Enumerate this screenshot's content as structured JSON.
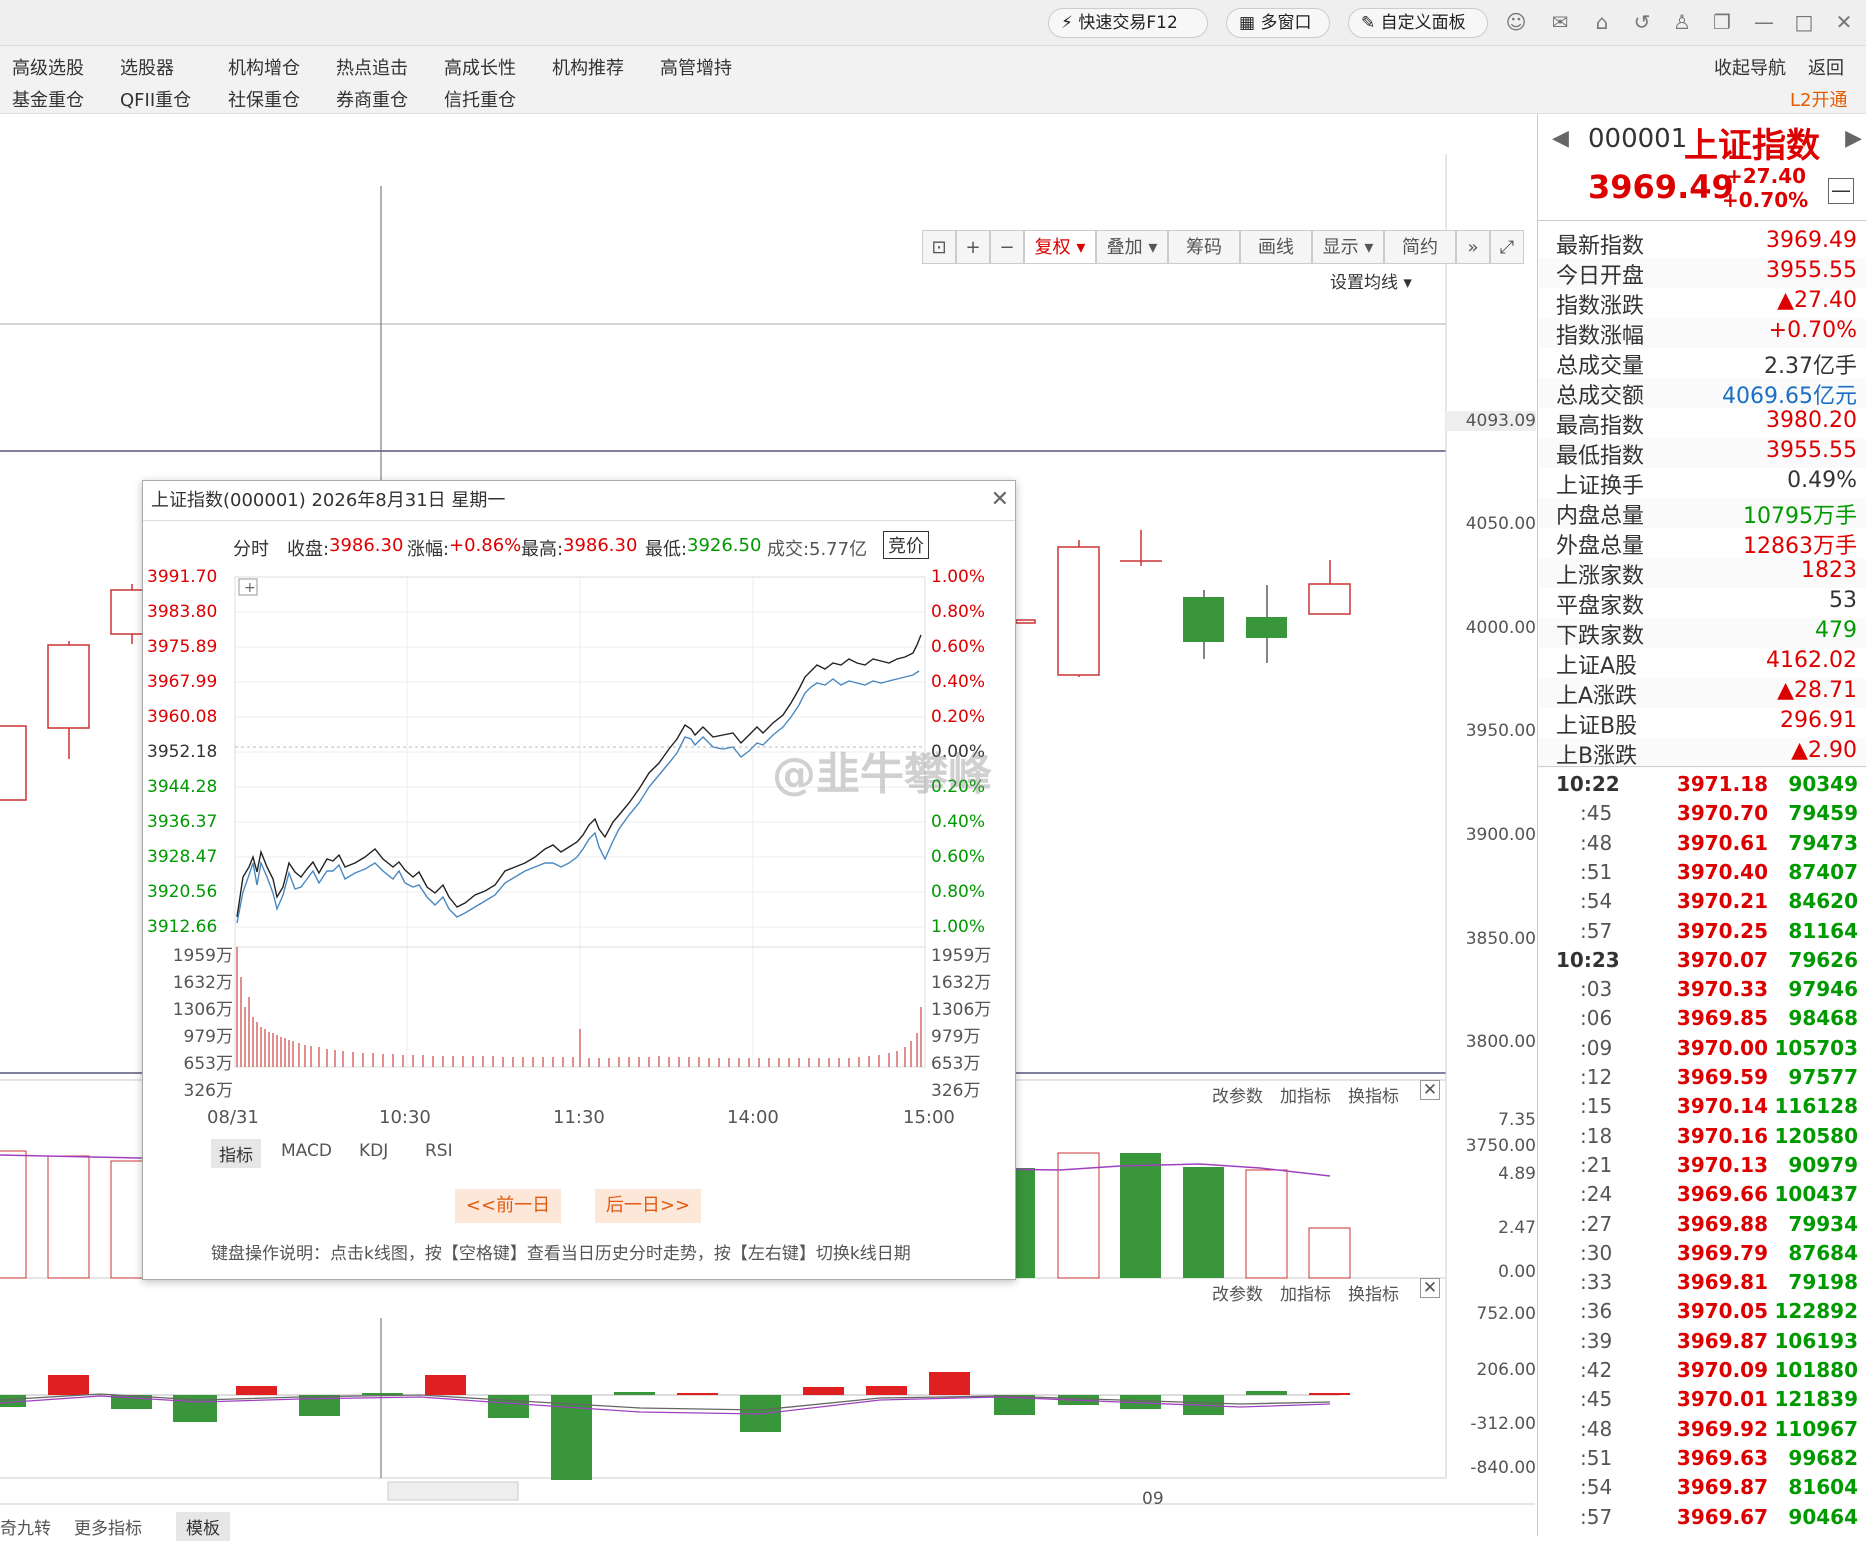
{
  "topbar": {
    "quick_trade": "快速交易F12",
    "multi_window": "多窗口",
    "custom_panel": "自定义面板"
  },
  "nav": {
    "row1": [
      "高级选股",
      "选股器",
      "机构增仓",
      "热点追击",
      "高成长性",
      "机构推荐",
      "高管增持"
    ],
    "row2": [
      "基金重仓",
      "QFII重仓",
      "社保重仓",
      "券商重仓",
      "信托重仓"
    ],
    "collapse": "收起导航",
    "back": "返回",
    "l2": "L2开通"
  },
  "toolbar": {
    "fuquan": "复权",
    "overlay": "叠加",
    "chips": "筹码",
    "draw": "画线",
    "display": "显示",
    "simple": "简约",
    "set_ma": "设置均线"
  },
  "price_axis": [
    "4093.09",
    "4050.00",
    "4000.00",
    "3950.00",
    "3900.00",
    "3850.00",
    "3800.00",
    "3750.00"
  ],
  "vol_axis": [
    "7.35",
    "4.89",
    "2.47",
    "0.00"
  ],
  "macd_axis": [
    "752.00",
    "206.00",
    "-312.00",
    "-840.00"
  ],
  "panel_ctrl": {
    "change_param": "改参数",
    "add_indicator": "加指标",
    "switch_indicator": "换指标"
  },
  "bottom": {
    "date_label": "09",
    "tab1": "奇九转",
    "tab2": "更多指标",
    "tab3": "模板"
  },
  "quote": {
    "code": "000001",
    "name": "上证指数",
    "price": "3969.49",
    "change": "+27.40",
    "pct": "+0.70%",
    "rows": [
      {
        "k": "最新指数",
        "v": "3969.49",
        "c": "red"
      },
      {
        "k": "今日开盘",
        "v": "3955.55",
        "c": "red"
      },
      {
        "k": "指数涨跌",
        "v": "▲27.40",
        "c": "red"
      },
      {
        "k": "指数涨幅",
        "v": "+0.70%",
        "c": "red"
      },
      {
        "k": "总成交量",
        "v": "2.37亿手",
        "c": ""
      },
      {
        "k": "总成交额",
        "v": "4069.65亿元",
        "c": "blue"
      },
      {
        "k": "最高指数",
        "v": "3980.20",
        "c": "red"
      },
      {
        "k": "最低指数",
        "v": "3955.55",
        "c": "red"
      },
      {
        "k": "上证换手",
        "v": "0.49%",
        "c": ""
      },
      {
        "k": "内盘总量",
        "v": "10795万手",
        "c": "green"
      },
      {
        "k": "外盘总量",
        "v": "12863万手",
        "c": "red"
      },
      {
        "k": "上涨家数",
        "v": "1823",
        "c": "red"
      },
      {
        "k": "平盘家数",
        "v": "53",
        "c": ""
      },
      {
        "k": "下跌家数",
        "v": "479",
        "c": "green"
      },
      {
        "k": "上证A股",
        "v": "4162.02",
        "c": "red"
      },
      {
        "k": "上A涨跌",
        "v": "▲28.71",
        "c": "red"
      },
      {
        "k": "上证B股",
        "v": "296.91",
        "c": "red"
      },
      {
        "k": "上B涨跌",
        "v": "▲2.90",
        "c": "red"
      }
    ]
  },
  "ticks": [
    {
      "t": "10:22",
      "p": "3971.18",
      "v": "90349"
    },
    {
      "t": ":45",
      "p": "3970.70",
      "v": "79459"
    },
    {
      "t": ":48",
      "p": "3970.61",
      "v": "79473"
    },
    {
      "t": ":51",
      "p": "3970.40",
      "v": "87407"
    },
    {
      "t": ":54",
      "p": "3970.21",
      "v": "84620"
    },
    {
      "t": ":57",
      "p": "3970.25",
      "v": "81164"
    },
    {
      "t": "10:23",
      "p": "3970.07",
      "v": "79626"
    },
    {
      "t": ":03",
      "p": "3970.33",
      "v": "97946"
    },
    {
      "t": ":06",
      "p": "3969.85",
      "v": "98468"
    },
    {
      "t": ":09",
      "p": "3970.00",
      "v": "105703"
    },
    {
      "t": ":12",
      "p": "3969.59",
      "v": "97577"
    },
    {
      "t": ":15",
      "p": "3970.14",
      "v": "116128"
    },
    {
      "t": ":18",
      "p": "3970.16",
      "v": "120580"
    },
    {
      "t": ":21",
      "p": "3970.13",
      "v": "90979"
    },
    {
      "t": ":24",
      "p": "3969.66",
      "v": "100437"
    },
    {
      "t": ":27",
      "p": "3969.88",
      "v": "79934"
    },
    {
      "t": ":30",
      "p": "3969.79",
      "v": "87684"
    },
    {
      "t": ":33",
      "p": "3969.81",
      "v": "79198"
    },
    {
      "t": ":36",
      "p": "3970.05",
      "v": "122892"
    },
    {
      "t": ":39",
      "p": "3969.87",
      "v": "106193"
    },
    {
      "t": ":42",
      "p": "3970.09",
      "v": "101880"
    },
    {
      "t": ":45",
      "p": "3970.01",
      "v": "121839"
    },
    {
      "t": ":48",
      "p": "3969.92",
      "v": "110967"
    },
    {
      "t": ":51",
      "p": "3969.63",
      "v": "99682"
    },
    {
      "t": ":54",
      "p": "3969.87",
      "v": "81604"
    },
    {
      "t": ":57",
      "p": "3969.67",
      "v": "90464"
    }
  ],
  "popup": {
    "title": "上证指数(000001) 2026年8月31日 星期一",
    "tab": "分时",
    "close_lbl": "收盘:",
    "close": "3986.30",
    "chg_lbl": "涨幅:",
    "chg": "+0.86%",
    "high_lbl": "最高:",
    "high": "3986.30",
    "low_lbl": "最低:",
    "low": "3926.50",
    "amt_lbl": "成交:",
    "amt": "5.77亿",
    "auction": "竞价",
    "price_left": [
      "3991.70",
      "3983.80",
      "3975.89",
      "3967.99",
      "3960.08",
      "3952.18",
      "3944.28",
      "3936.37",
      "3928.47",
      "3920.56",
      "3912.66"
    ],
    "pct_right": [
      "1.00%",
      "0.80%",
      "0.60%",
      "0.40%",
      "0.20%",
      "0.00%",
      "0.20%",
      "0.40%",
      "0.60%",
      "0.80%",
      "1.00%"
    ],
    "vol_labels": [
      "1959万",
      "1632万",
      "1306万",
      "979万",
      "653万",
      "326万"
    ],
    "time_labels": [
      "08/31",
      "10:30",
      "11:30",
      "14:00",
      "15:00"
    ],
    "ind_tabs": [
      "指标",
      "MACD",
      "KDJ",
      "RSI"
    ],
    "prev": "<<前一日",
    "next": "后一日>>",
    "help": "键盘操作说明：点击k线图，按【空格键】查看当日历史分时走势，按【左右键】切换k线日期"
  },
  "watermark": "@韭牛攀峰"
}
